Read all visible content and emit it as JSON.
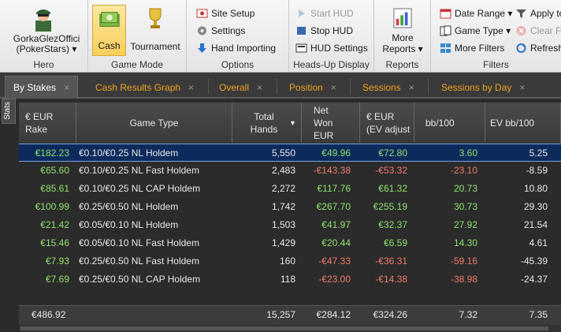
{
  "ribbon": {
    "hero": {
      "name": "GorkaGlezOffici",
      "site": "(PokerStars)",
      "dropdown": "▾",
      "label": "Hero"
    },
    "game_mode": {
      "cash": "Cash",
      "tournament": "Tournament",
      "label": "Game Mode"
    },
    "options": {
      "site_setup": "Site Setup",
      "settings": "Settings",
      "hand_importing": "Hand Importing",
      "label": "Options"
    },
    "hud": {
      "start": "Start HUD",
      "stop": "Stop HUD",
      "settings": "HUD Settings",
      "label": "Heads-Up Display"
    },
    "reports": {
      "more": "More",
      "reports": "Reports ▾",
      "label": "Reports"
    },
    "filters": {
      "date_range": "Date Range ▾",
      "game_type": "Game Type ▾",
      "more_filters": "More Filters",
      "apply": "Apply to",
      "clear": "Clear Fi",
      "refresh": "Refresh",
      "label": "Filters"
    }
  },
  "tabs": [
    {
      "label": "By Stakes",
      "close": "×"
    },
    {
      "label": "Cash Results Graph",
      "close": "×"
    },
    {
      "label": "Overall",
      "close": "×"
    },
    {
      "label": "Position",
      "close": "×"
    },
    {
      "label": "Sessions",
      "close": "×"
    },
    {
      "label": "Sessions by Day",
      "close": "×"
    }
  ],
  "side_tab": "Stats",
  "headers": {
    "rake": "€ EUR Rake",
    "game_type": "Game Type",
    "total_hands": "Total Hands",
    "sort_icon": "▼",
    "net_won": "Net Won EUR",
    "ev_eur": "€ EUR (EV adjust",
    "bb100": "bb/100",
    "ev_bb100": "EV bb/100"
  },
  "rows": [
    {
      "rake": "€182.23",
      "game": "€0.10/€0.25 NL Holdem",
      "hands": "5,550",
      "net": "€49.96",
      "ev": "€72.80",
      "bb": "3.60",
      "evbb": "5.25"
    },
    {
      "rake": "€65.60",
      "game": "€0.10/€0.25 NL Fast Holdem",
      "hands": "2,483",
      "net": "-€143.38",
      "ev": "-€53.32",
      "bb": "-23.10",
      "evbb": "-8.59"
    },
    {
      "rake": "€85.61",
      "game": "€0.10/€0.25 NL CAP Holdem",
      "hands": "2,272",
      "net": "€117.76",
      "ev": "€61.32",
      "bb": "20.73",
      "evbb": "10.80"
    },
    {
      "rake": "€100.99",
      "game": "€0.25/€0.50 NL Holdem",
      "hands": "1,742",
      "net": "€267.70",
      "ev": "€255.19",
      "bb": "30.73",
      "evbb": "29.30"
    },
    {
      "rake": "€21.42",
      "game": "€0.05/€0.10 NL Holdem",
      "hands": "1,503",
      "net": "€41.97",
      "ev": "€32.37",
      "bb": "27.92",
      "evbb": "21.54"
    },
    {
      "rake": "€15.46",
      "game": "€0.05/€0.10 NL Fast Holdem",
      "hands": "1,429",
      "net": "€20.44",
      "ev": "€6.59",
      "bb": "14.30",
      "evbb": "4.61"
    },
    {
      "rake": "€7.93",
      "game": "€0.25/€0.50 NL Fast Holdem",
      "hands": "160",
      "net": "-€47.33",
      "ev": "-€36.31",
      "bb": "-59.16",
      "evbb": "-45.39"
    },
    {
      "rake": "€7.69",
      "game": "€0.25/€0.50 NL CAP Holdem",
      "hands": "118",
      "net": "-€23.00",
      "ev": "-€14.38",
      "bb": "-38.98",
      "evbb": "-24.37"
    }
  ],
  "totals": {
    "rake": "€486.92",
    "hands": "15,257",
    "net": "€284.12",
    "ev": "€324.26",
    "bb": "7.32",
    "evbb": "7.35"
  },
  "colors": {
    "positive": "#8ee26e",
    "negative": "#f07a6a",
    "neutral": "#e8e8e8",
    "tab_inactive": "#f0a020",
    "selected_row": "#0d2a5c"
  }
}
